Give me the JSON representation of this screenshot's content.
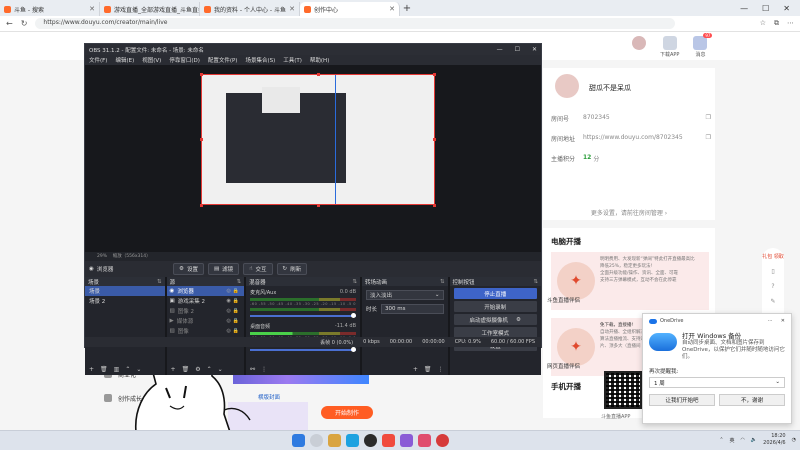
{
  "browser": {
    "tabs": [
      {
        "label": "斗鱼 - 搜索",
        "color": "#ff6a2b"
      },
      {
        "label": "游戏直播_全部游戏直播_斗鱼直播",
        "color": "#ff6a2b"
      },
      {
        "label": "我的资料 - 个人中心 - 斗鱼",
        "color": "#ff6a2b"
      },
      {
        "label": "创作中心",
        "color": "#ff6a2b"
      }
    ],
    "url": "https://www.douyu.com/creator/main/live",
    "new_tab": "+",
    "back": "←",
    "reload": "↻",
    "win_min": "—",
    "win_max": "☐",
    "win_close": "✕"
  },
  "header": {
    "download": "下载APP",
    "messages": "消息",
    "msg_badge": "97"
  },
  "profile": {
    "name": "甜瓜不是呆瓜",
    "room_no_label": "房间号",
    "room_no": "8702345",
    "room_url_label": "房间地址",
    "room_url": "https://www.douyu.com/8702345",
    "score_label": "主播积分",
    "score": "12",
    "score_unit": "分",
    "link": "更多设置，请前往房间管理 ›"
  },
  "live_section": {
    "title": "电脑开播",
    "item1_name": "斗鱼直播伴侣",
    "item1_lines": [
      "明明费用、大发现新“弹阔”特此打开直播最高比",
      "降低25%，稳定更多玩法!",
      "全面升级功能/操作、资讯、全面、可靠",
      "支持三方弹幕模式，互动不会在此停靠"
    ],
    "item2_name": "网页直播伴侣",
    "item2_lines": [
      "免下载，直接播!",
      "自动开播、全组织解决快速开播",
      "算法直播推流、支持进单节",
      "片、顶多大（直播间"
    ],
    "phone_title": "手机开播",
    "qr_caption": "斗鱼直播APP"
  },
  "left_menu": [
    "资源",
    "商业化",
    "创作成长"
  ],
  "banner": "斗鱼直播 热门封面制作指南",
  "thumb_caption": "横版封面",
  "start_button": "开始制作",
  "side_float": {
    "gift": "礼包 领取"
  },
  "obs": {
    "title": "OBS 31.1.2 - 配置文件: 未命名 - 场景: 未命名",
    "menus": [
      "文件(F)",
      "编辑(E)",
      "视图(V)",
      "停靠窗口(D)",
      "配置文件(P)",
      "场景集合(S)",
      "工具(T)",
      "帮助(H)"
    ],
    "zoom": "29%",
    "zoom_info": "缩放（556x314）",
    "toolbar": {
      "source": "浏览器",
      "settings": "设置",
      "filters": "滤镜",
      "interact": "交互",
      "refresh": "刷新"
    },
    "scenes": {
      "title": "场景",
      "items": [
        "场景",
        "场景 2"
      ]
    },
    "sources": {
      "title": "源",
      "items": [
        {
          "name": "浏览器",
          "state": "sel"
        },
        {
          "name": "游戏采集 2",
          "state": "normal"
        },
        {
          "name": "图像 2",
          "state": "dim"
        },
        {
          "name": "媒体源",
          "state": "dim"
        },
        {
          "name": "图像",
          "state": "dim"
        }
      ]
    },
    "mixer": {
      "title": "混音器",
      "channels": [
        {
          "name": "麦克风/Aux",
          "db": "0.0 dB",
          "live": false
        },
        {
          "name": "桌面音频",
          "db": "-11.4 dB",
          "live": true
        }
      ],
      "scale": "-60 -55 -50 -45 -40 -35 -30 -25 -20 -15 -10 -5 0"
    },
    "transitions": {
      "title": "转场动画",
      "type": "淡入淡出",
      "duration_label": "时长",
      "duration": "300 ms"
    },
    "controls": {
      "title": "控制按钮",
      "stop_stream": "停止直播",
      "start_record": "开始录制",
      "virtual_cam": "启动虚拟摄像机",
      "studio_mode": "工作室模式",
      "settings": "设置"
    },
    "status": {
      "dropped": "丢帧 0 (0.0%)",
      "bitrate": "0 kbps",
      "stream_time": "00:00:00",
      "record_time": "00:00:00",
      "cpu": "CPU: 0.9%",
      "fps": "60.00 / 60.00 FPS"
    }
  },
  "onedrive": {
    "app": "OneDrive",
    "title": "打开 Windows 备份",
    "text": "自动同步桌面、文档和图片保存到 OneDrive，以保护它们并随时随地访问它们。",
    "remind_label": "再次提醒我:",
    "remind_value": "1 周",
    "btn_yes": "让我们开始吧",
    "btn_no": "不，谢谢"
  },
  "taskbar": {
    "lang": "英",
    "time": "18:20",
    "date": "2026/4/6"
  },
  "colors": {
    "accent": "#ff5d23",
    "obs_select": "#3a5ba8",
    "obs_primary": "#3e64c8"
  }
}
